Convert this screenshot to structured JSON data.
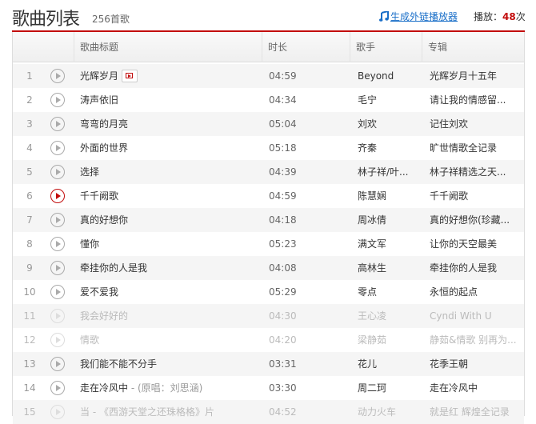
{
  "header": {
    "title": "歌曲列表",
    "count": "256首歌",
    "generate_link": "生成外链播放器",
    "plays_label": "播放：",
    "plays_value": "48",
    "plays_unit": "次"
  },
  "columns": [
    "歌曲标题",
    "时长",
    "歌手",
    "专辑"
  ],
  "songs": [
    {
      "num": "1",
      "title": "光辉岁月",
      "sub": "",
      "duration": "04:59",
      "singer": "Beyond",
      "album": "光辉岁月十五年",
      "mv": true
    },
    {
      "num": "2",
      "title": "涛声依旧",
      "sub": "",
      "duration": "04:34",
      "singer": "毛宁",
      "album": "请让我的情感留..."
    },
    {
      "num": "3",
      "title": "弯弯的月亮",
      "sub": "",
      "duration": "05:04",
      "singer": "刘欢",
      "album": "记住刘欢"
    },
    {
      "num": "4",
      "title": "外面的世界",
      "sub": "",
      "duration": "05:18",
      "singer": "齐秦",
      "album": "旷世情歌全记录"
    },
    {
      "num": "5",
      "title": "选择",
      "sub": "",
      "duration": "04:39",
      "singer": "林子祥/叶...",
      "album": "林子祥精选之天..."
    },
    {
      "num": "6",
      "title": "千千阙歌",
      "sub": "",
      "duration": "04:59",
      "singer": "陈慧娴",
      "album": "千千阙歌",
      "active": true
    },
    {
      "num": "7",
      "title": "真的好想你",
      "sub": "",
      "duration": "04:18",
      "singer": "周冰倩",
      "album": "真的好想你(珍藏..."
    },
    {
      "num": "8",
      "title": "懂你",
      "sub": "",
      "duration": "05:23",
      "singer": "满文军",
      "album": "让你的天空最美"
    },
    {
      "num": "9",
      "title": "牵挂你的人是我",
      "sub": "",
      "duration": "04:08",
      "singer": "高林生",
      "album": "牵挂你的人是我"
    },
    {
      "num": "10",
      "title": "爱不爱我",
      "sub": "",
      "duration": "05:29",
      "singer": "零点",
      "album": "永恒的起点"
    },
    {
      "num": "11",
      "title": "我会好好的",
      "sub": "",
      "duration": "04:30",
      "singer": "王心凌",
      "album": "Cyndi With U",
      "disabled": true
    },
    {
      "num": "12",
      "title": "情歌",
      "sub": "",
      "duration": "04:20",
      "singer": "梁静茹",
      "album": "静茹&情歌 别再为...",
      "disabled": true
    },
    {
      "num": "13",
      "title": "我们能不能不分手",
      "sub": "",
      "duration": "03:31",
      "singer": "花儿",
      "album": "花季王朝"
    },
    {
      "num": "14",
      "title": "走在冷风中",
      "sub": " - (原唱：刘思涵)",
      "duration": "03:30",
      "singer": "周二珂",
      "album": "走在冷风中"
    },
    {
      "num": "15",
      "title": "当 - 《西游天堂之还珠格格》片",
      "sub": "",
      "duration": "04:52",
      "singer": "动力火车",
      "album": "就是红 辉煌全记录",
      "disabled": true
    }
  ]
}
